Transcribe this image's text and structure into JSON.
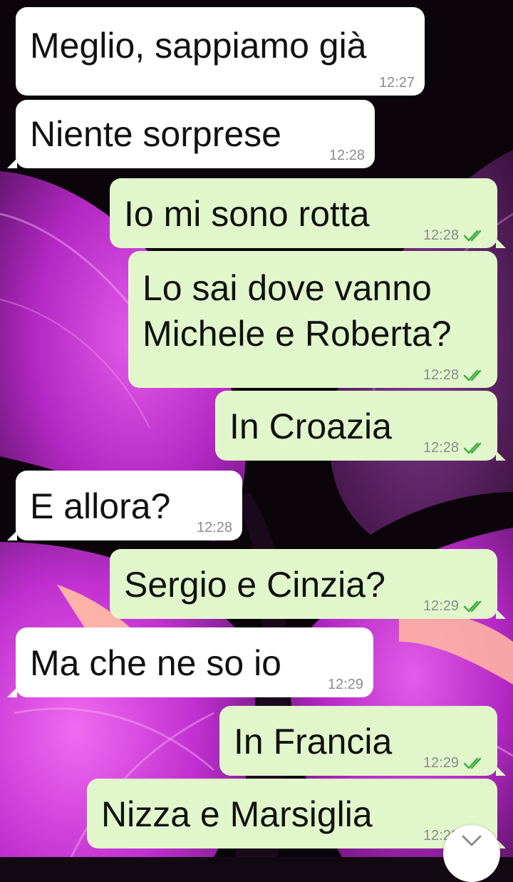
{
  "wallpaper": {
    "subject": "purple-butterfly-wing",
    "colors": [
      "#d63fe0",
      "#a018b3",
      "#6b1f79",
      "#ffb2a0",
      "#070307"
    ]
  },
  "colors": {
    "incoming_bubble": "#ffffff",
    "outgoing_bubble": "#e1f7cb",
    "read_ticks": "#4fc3f7",
    "timestamp": "#8c8c8c"
  },
  "messages": [
    {
      "direction": "incoming",
      "text": "Meglio, sappiamo già",
      "time": "12:27"
    },
    {
      "direction": "incoming",
      "text": "Niente sorprese",
      "time": "12:28"
    },
    {
      "direction": "outgoing",
      "text": "Io mi sono rotta",
      "time": "12:28",
      "status": "read"
    },
    {
      "direction": "outgoing",
      "text": "Lo sai dove vanno\nMichele e Roberta?",
      "time": "12:28",
      "status": "read"
    },
    {
      "direction": "outgoing",
      "text": "In Croazia",
      "time": "12:28",
      "status": "read"
    },
    {
      "direction": "incoming",
      "text": "E allora?",
      "time": "12:28"
    },
    {
      "direction": "outgoing",
      "text": "Sergio e Cinzia?",
      "time": "12:29",
      "status": "read"
    },
    {
      "direction": "incoming",
      "text": "Ma che ne so io",
      "time": "12:29"
    },
    {
      "direction": "outgoing",
      "text": "In Francia",
      "time": "12:29",
      "status": "read"
    },
    {
      "direction": "outgoing",
      "text": "Nizza e Marsiglia",
      "time": "12:29",
      "status": "read"
    }
  ],
  "scroll_down_button": {
    "icon": "chevron-down-icon"
  }
}
